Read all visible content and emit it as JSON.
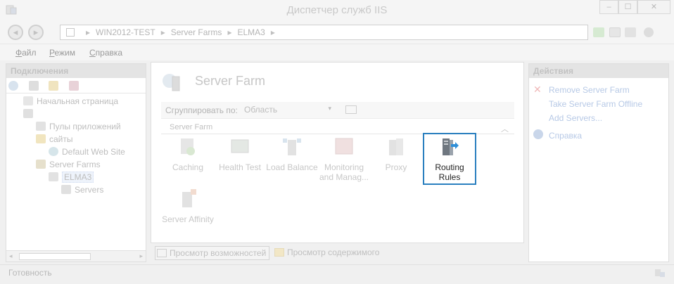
{
  "window": {
    "title": "Диспетчер служб IIS",
    "controls": {
      "minimize": "–",
      "maximize": "☐",
      "close": "✕"
    }
  },
  "address_bar": {
    "segments": [
      "WIN2012-TEST",
      "Server Farms",
      "ELMA3"
    ],
    "separator": "▸"
  },
  "menu": [
    "Файл",
    "Режим",
    "Справка"
  ],
  "connections": {
    "header": "Подключения",
    "tree": [
      {
        "label": "Начальная страница",
        "icon": "home-icon"
      },
      {
        "label": "",
        "icon": "server-icon",
        "note": "redacted host name"
      },
      {
        "label": "Пулы приложений",
        "icon": "app-pool-icon"
      },
      {
        "label": "сайты",
        "icon": "folder-icon"
      },
      {
        "label": "Default Web Site",
        "icon": "globe-icon"
      },
      {
        "label": "Server Farms",
        "icon": "server-farm-icon"
      },
      {
        "label": "ELMA3",
        "icon": "farm-node-icon",
        "selected": true
      },
      {
        "label": "Servers",
        "icon": "servers-icon"
      }
    ],
    "scroll": {
      "left": "◂",
      "right": "▸"
    }
  },
  "center": {
    "title": "Server Farm",
    "group_by_label": "Сгруппировать по:",
    "group_by_value": "Область",
    "section": "Server Farm",
    "collapse_glyph": "︿",
    "features": [
      {
        "label": "Caching",
        "icon": "caching-icon"
      },
      {
        "label": "Health Test",
        "icon": "health-test-icon"
      },
      {
        "label": "Load Balance",
        "icon": "load-balance-icon"
      },
      {
        "label": "Monitoring and Manag...",
        "icon": "monitoring-icon"
      },
      {
        "label": "Proxy",
        "icon": "proxy-icon"
      },
      {
        "label": "Routing Rules",
        "icon": "routing-rules-icon",
        "selected": true
      },
      {
        "label": "Server Affinity",
        "icon": "server-affinity-icon"
      }
    ],
    "view_tabs": [
      "Просмотр возможностей",
      "Просмотр содержимого"
    ]
  },
  "actions": {
    "header": "Действия",
    "items": [
      {
        "label": "Remove Server Farm",
        "icon": "delete-icon"
      },
      {
        "label": "Take Server Farm Offline",
        "icon": ""
      },
      {
        "label": "Add Servers...",
        "icon": ""
      },
      {
        "label": "Справка",
        "icon": "help-icon"
      }
    ]
  },
  "status": {
    "text": "Готовность"
  },
  "colors": {
    "selection_border": "#2a7fbf",
    "action_link": "#b7c9e6",
    "faded_text": "#c0c0c0"
  }
}
